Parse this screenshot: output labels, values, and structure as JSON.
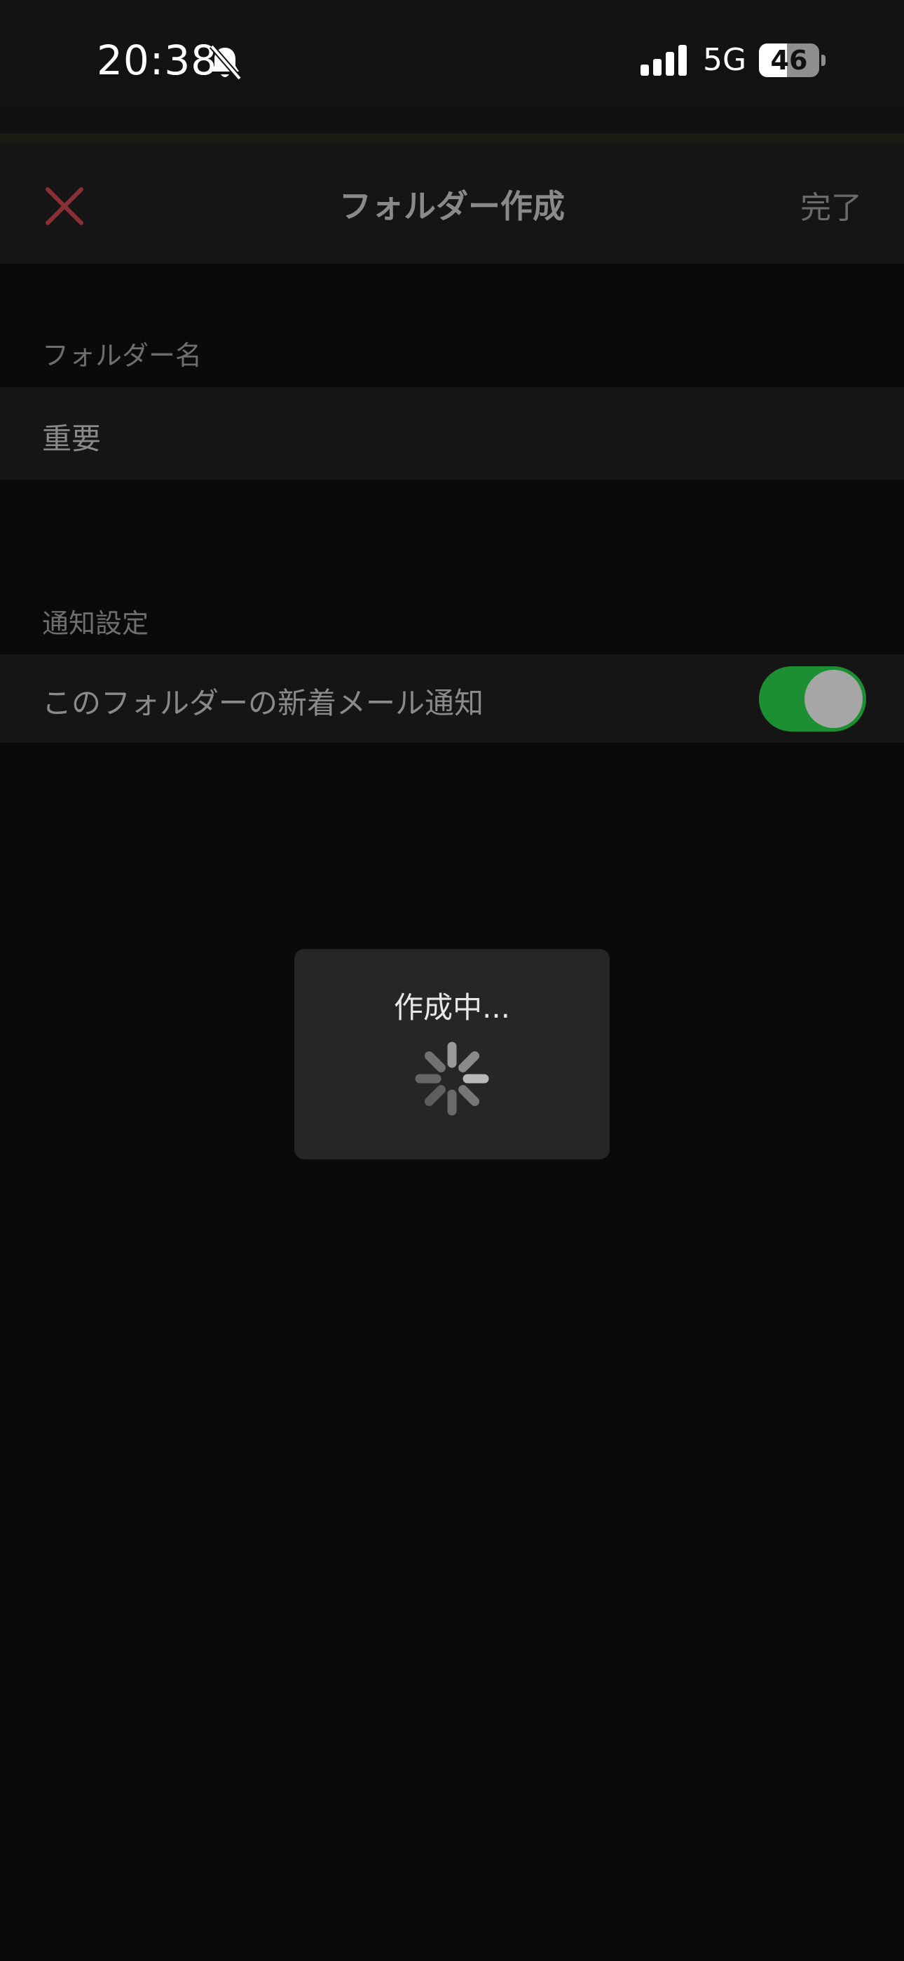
{
  "status_bar": {
    "time": "20:38",
    "silent_icon": "bell-slash-icon",
    "signal_icon": "cellular-signal-icon",
    "network": "5G",
    "battery_level": "46",
    "battery_fraction": 0.46
  },
  "nav": {
    "close_icon": "close-icon",
    "title": "フォルダー作成",
    "done_label": "完了"
  },
  "folder_name": {
    "section_label": "フォルダー名",
    "value": "重要"
  },
  "notifications": {
    "section_label": "通知設定",
    "toggle_label": "このフォルダーの新着メール通知",
    "toggle_on": true
  },
  "progress_hud": {
    "text": "作成中...",
    "spinner_icon": "activity-spinner-icon"
  },
  "colors": {
    "accent_close": "#8a2f33",
    "toggle_on": "#1d8f33",
    "background": "#0b0a0b",
    "row_background": "#161516"
  }
}
